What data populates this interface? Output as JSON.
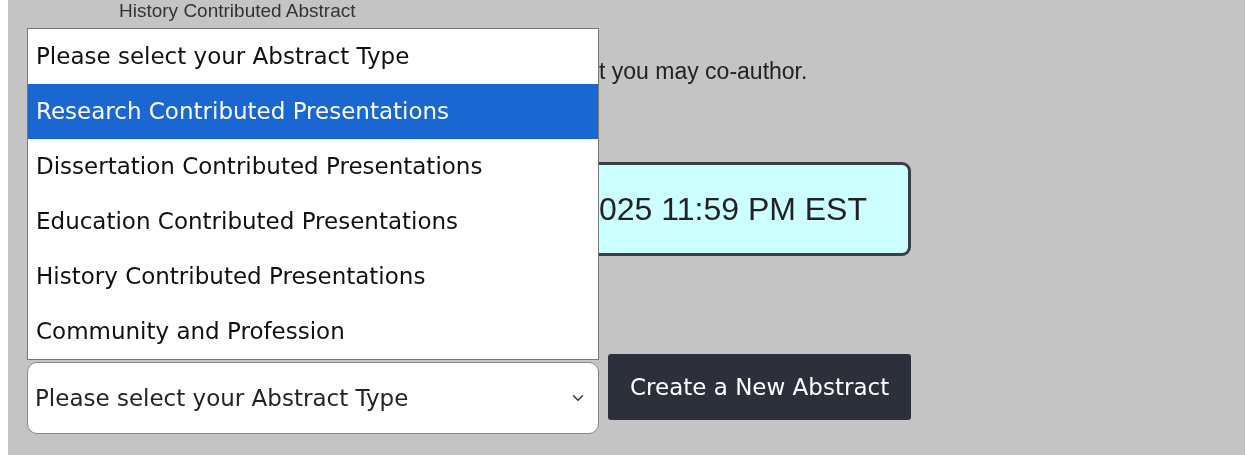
{
  "heading": "History Contributed Abstract",
  "dropdown_list": {
    "options": [
      {
        "label": "Please select your Abstract Type",
        "selected": false
      },
      {
        "label": "Research Contributed Presentations",
        "selected": true
      },
      {
        "label": "Dissertation Contributed Presentations",
        "selected": false
      },
      {
        "label": "Education Contributed Presentations",
        "selected": false
      },
      {
        "label": "History Contributed Presentations",
        "selected": false
      },
      {
        "label": "Community and Profession",
        "selected": false
      }
    ]
  },
  "note": "t you may co-author.",
  "deadline": "025 11:59 PM EST",
  "abstract_type_select": {
    "value": "Please select your Abstract Type"
  },
  "create_button": "Create a New Abstract"
}
